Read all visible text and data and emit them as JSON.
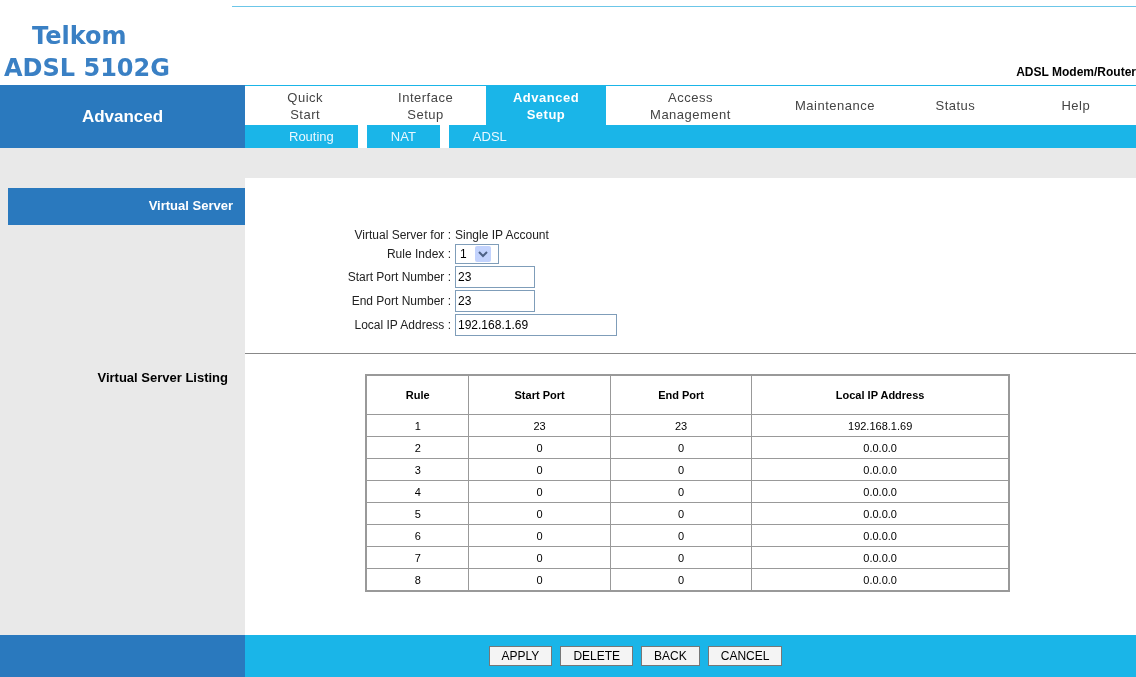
{
  "brand": {
    "name": "Telkom",
    "model": "ADSL 5102G",
    "tagline": "ADSL Modem/Router"
  },
  "section": "Advanced",
  "nav": [
    {
      "label": "Quick\nStart",
      "selected": false
    },
    {
      "label": "Interface\nSetup",
      "selected": false
    },
    {
      "label": "Advanced\nSetup",
      "selected": true
    },
    {
      "label": "Access\nManagement",
      "selected": false
    },
    {
      "label": "Maintenance",
      "selected": false
    },
    {
      "label": "Status",
      "selected": false
    },
    {
      "label": "Help",
      "selected": false
    }
  ],
  "subnav": [
    "Routing",
    "NAT",
    "ADSL"
  ],
  "panel_title": "Virtual Server",
  "form": [
    {
      "kind": "text",
      "label": "Virtual Server for :",
      "value": "Single IP Account"
    },
    {
      "kind": "select",
      "label": "Rule Index :",
      "value": "1"
    },
    {
      "kind": "input",
      "label": "Start Port Number :",
      "value": "23"
    },
    {
      "kind": "input",
      "label": "End Port Number :",
      "value": "23"
    },
    {
      "kind": "wide-input",
      "label": "Local IP Address :",
      "value": "192.168.1.69"
    }
  ],
  "listing_title": "Virtual Server Listing",
  "table": {
    "columns": [
      "Rule",
      "Start Port",
      "End Port",
      "Local IP Address"
    ],
    "rows": [
      [
        "1",
        "23",
        "23",
        "192.168.1.69"
      ],
      [
        "2",
        "0",
        "0",
        "0.0.0.0"
      ],
      [
        "3",
        "0",
        "0",
        "0.0.0.0"
      ],
      [
        "4",
        "0",
        "0",
        "0.0.0.0"
      ],
      [
        "5",
        "0",
        "0",
        "0.0.0.0"
      ],
      [
        "6",
        "0",
        "0",
        "0.0.0.0"
      ],
      [
        "7",
        "0",
        "0",
        "0.0.0.0"
      ],
      [
        "8",
        "0",
        "0",
        "0.0.0.0"
      ]
    ]
  },
  "buttons": [
    "APPLY",
    "DELETE",
    "BACK",
    "CANCEL"
  ]
}
